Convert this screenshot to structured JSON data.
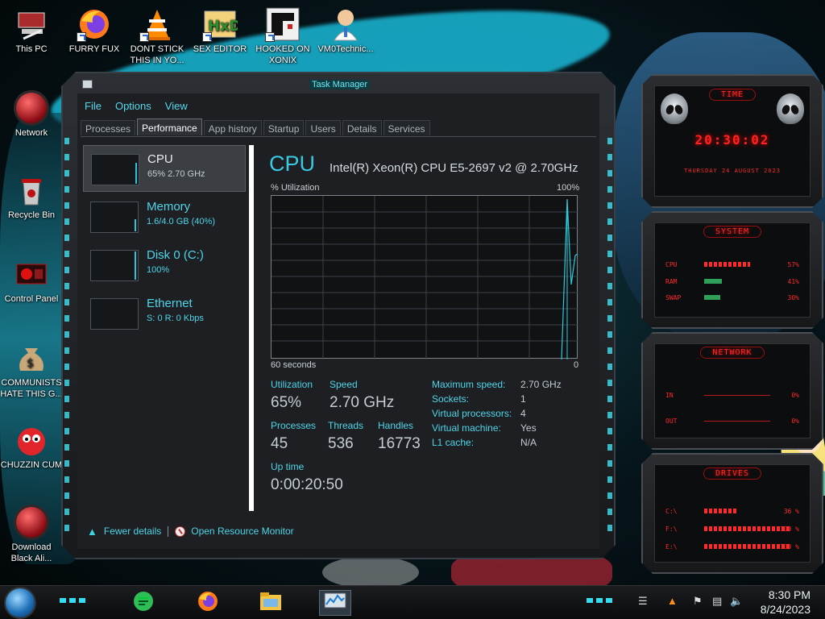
{
  "desktop": {
    "icons": [
      {
        "label": "This PC",
        "icon": "this-pc-icon"
      },
      {
        "label": "FURRY FUX",
        "icon": "firefox-icon"
      },
      {
        "label": "DONT STICK THIS IN YO...",
        "icon": "vlc-icon"
      },
      {
        "label": "SEX EDITOR",
        "icon": "hxd-icon"
      },
      {
        "label": "HOOKED ON XONIX",
        "icon": "xonix-icon"
      },
      {
        "label": "VM0Technic...",
        "icon": "doctor-icon"
      },
      {
        "label": "Network",
        "icon": "network-icon"
      },
      {
        "label": "Recycle Bin",
        "icon": "recycle-bin-icon"
      },
      {
        "label": "Control Panel",
        "icon": "control-panel-icon"
      },
      {
        "label": "COMMUNISTS HATE THIS G...",
        "icon": "money-bag-icon"
      },
      {
        "label": "CHUZZIN CUM",
        "icon": "chuzzle-icon"
      },
      {
        "label": "Download Black Ali...",
        "icon": "alienware-icon"
      }
    ]
  },
  "window": {
    "title": "Task Manager",
    "menu": [
      "File",
      "Options",
      "View"
    ],
    "tabs": [
      "Processes",
      "Performance",
      "App history",
      "Startup",
      "Users",
      "Details",
      "Services"
    ],
    "active_tab": "Performance",
    "sidebar": [
      {
        "title": "CPU",
        "sub": "65%  2.70 GHz",
        "selected": true
      },
      {
        "title": "Memory",
        "sub": "1.6/4.0 GB (40%)",
        "selected": false
      },
      {
        "title": "Disk 0 (C:)",
        "sub": "100%",
        "selected": false
      },
      {
        "title": "Ethernet",
        "sub": "S: 0 R: 0 Kbps",
        "selected": false
      }
    ],
    "main": {
      "heading": "CPU",
      "model": "Intel(R) Xeon(R) CPU E5-2697 v2 @ 2.70GHz",
      "graph_label": "% Utilization",
      "graph_max": "100%",
      "graph_left": "60 seconds",
      "graph_right": "0",
      "utilization_label": "Utilization",
      "utilization": "65%",
      "speed_label": "Speed",
      "speed": "2.70 GHz",
      "processes_label": "Processes",
      "processes": "45",
      "threads_label": "Threads",
      "threads": "536",
      "handles_label": "Handles",
      "handles": "16773",
      "uptime_label": "Up time",
      "uptime": "0:00:20:50",
      "details": [
        {
          "k": "Maximum speed:",
          "v": "2.70 GHz"
        },
        {
          "k": "Sockets:",
          "v": "1"
        },
        {
          "k": "Virtual processors:",
          "v": "4"
        },
        {
          "k": "Virtual machine:",
          "v": "Yes"
        },
        {
          "k": "L1 cache:",
          "v": "N/A"
        }
      ]
    },
    "footer": {
      "fewer_details": "Fewer details",
      "open_resource_monitor": "Open Resource Monitor"
    }
  },
  "gadgets": {
    "time": {
      "title": "TIME",
      "clock": "20:30:02",
      "date": "THURSDAY 24 AUGUST 2023"
    },
    "system": {
      "title": "SYSTEM",
      "rows": [
        {
          "k": "CPU",
          "v": "57%",
          "level": 0.57
        },
        {
          "k": "RAM",
          "v": "41%",
          "level": 0.41
        },
        {
          "k": "SWAP",
          "v": "30%",
          "level": 0.3
        }
      ]
    },
    "network": {
      "title": "NETWORK",
      "rows": [
        {
          "k": "IN",
          "v": "0%"
        },
        {
          "k": "OUT",
          "v": "0%"
        }
      ]
    },
    "drives": {
      "title": "DRIVES",
      "rows": [
        {
          "k": "C:\\",
          "v": "36 %",
          "level": 0.36
        },
        {
          "k": "F:\\",
          "v": "100 %",
          "level": 1.0
        },
        {
          "k": "E:\\",
          "v": "100 %",
          "level": 1.0
        }
      ]
    }
  },
  "taskbar": {
    "time": "8:30 PM",
    "date": "8/24/2023",
    "apps": [
      "notes-icon",
      "firefox-icon",
      "file-explorer-icon",
      "task-manager-icon"
    ]
  },
  "colors": {
    "accent": "#39c9e3",
    "gadget_red": "#ff2a2a",
    "background": "#1d1f22"
  }
}
